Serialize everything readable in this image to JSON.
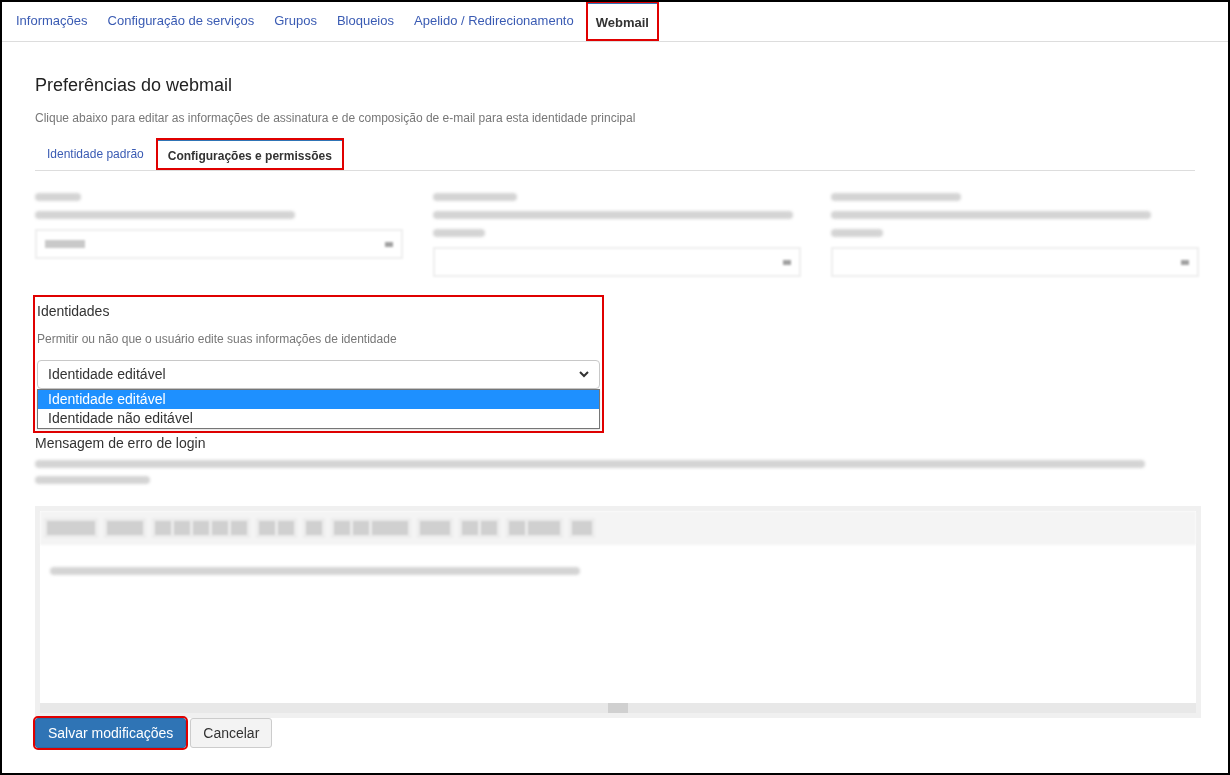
{
  "tabs": [
    {
      "label": "Informações",
      "selected": false,
      "highlighted": false
    },
    {
      "label": "Configuração de serviços",
      "selected": false,
      "highlighted": false
    },
    {
      "label": "Grupos",
      "selected": false,
      "highlighted": false
    },
    {
      "label": "Bloqueios",
      "selected": false,
      "highlighted": false
    },
    {
      "label": "Apelido / Redirecionamento",
      "selected": false,
      "highlighted": false
    },
    {
      "label": "Webmail",
      "selected": true,
      "highlighted": true
    }
  ],
  "title": "Preferências do webmail",
  "subtitle": "Clique abaixo para editar as informações de assinatura e de composição de e-mail para esta identidade principal",
  "subtabs": [
    {
      "label": "Identidade padrão",
      "selected": false,
      "highlighted": false
    },
    {
      "label": "Configurações e permissões",
      "selected": true,
      "highlighted": true
    }
  ],
  "identities": {
    "label": "Identidades",
    "description": "Permitir ou não que o usuário edite suas informações de identidade",
    "value": "Identidade editável",
    "expanded": true,
    "highlighted": true,
    "options": [
      {
        "label": "Identidade editável",
        "selected": true
      },
      {
        "label": "Identidade não editável",
        "selected": false
      }
    ]
  },
  "login_error": {
    "label": "Mensagem de erro de login"
  },
  "buttons": [
    {
      "label": "Salvar modificações",
      "kind": "primary",
      "highlighted": true
    },
    {
      "label": "Cancelar",
      "kind": "secondary",
      "highlighted": false
    }
  ]
}
